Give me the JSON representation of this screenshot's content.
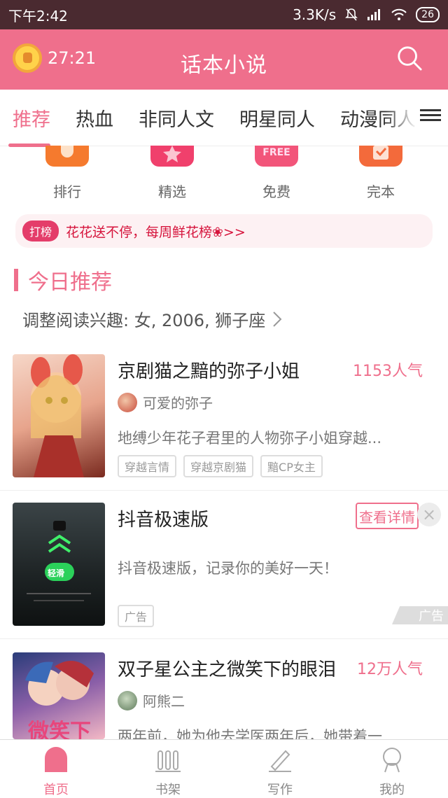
{
  "status": {
    "time": "下午2:42",
    "speed": "3.3K/s",
    "battery": "26"
  },
  "header": {
    "timer": "27:21",
    "title": "话本小说"
  },
  "tabs": [
    "推荐",
    "热血",
    "非同人文",
    "明星同人",
    "动漫同人"
  ],
  "quick": [
    {
      "label": "排行",
      "color": "#f57a2e",
      "icon": "trophy-icon"
    },
    {
      "label": "精选",
      "color": "#f0406c",
      "icon": "star-icon"
    },
    {
      "label": "免费",
      "color": "#f2557a",
      "icon": "free-icon",
      "text": "FREE"
    },
    {
      "label": "完本",
      "color": "#f36a3b",
      "icon": "check-icon"
    }
  ],
  "banner": {
    "badge": "打榜",
    "text": "花花送不停，每周鲜花榜❀>>"
  },
  "section": {
    "title": "今日推荐",
    "prefs": "调整阅读兴趣: 女, 2006, 狮子座"
  },
  "cards": [
    {
      "title": "京剧猫之黯的弥子小姐",
      "popularity": "1153人气",
      "author": "可爱的弥子",
      "desc": "地缚少年花子君里的人物弥子小姐穿越...",
      "tags": [
        "穿越言情",
        "穿越京剧猫",
        "黯CP女主"
      ]
    },
    {
      "title": "抖音极速版",
      "button": "查看详情",
      "desc": "抖音极速版，记录你的美好一天！",
      "ad_label": "广告",
      "ad_mark": "广告",
      "slide_label": "轻滑"
    },
    {
      "title": "双子星公主之微笑下的眼泪",
      "popularity": "12万人气",
      "author": "阿熊二",
      "desc": "两年前，她为他去学医两年后，她带着一...",
      "cover_text": "微笑下"
    }
  ],
  "nav": [
    {
      "label": "首页",
      "icon": "home-icon"
    },
    {
      "label": "书架",
      "icon": "bookshelf-icon"
    },
    {
      "label": "写作",
      "icon": "pen-icon"
    },
    {
      "label": "我的",
      "icon": "profile-icon"
    }
  ],
  "colors": {
    "accent": "#ef6f8c",
    "statusbar": "#4a2a30"
  }
}
